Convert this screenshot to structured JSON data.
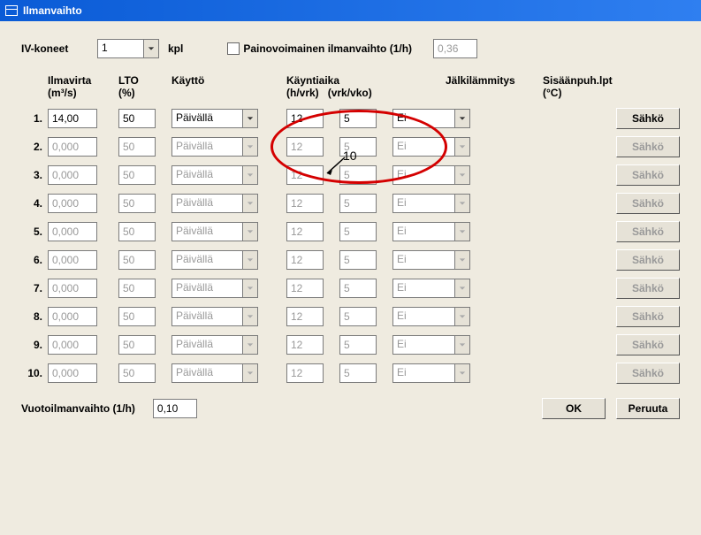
{
  "window": {
    "title": "Ilmanvaihto"
  },
  "top": {
    "ivkoneet_label": "IV-koneet",
    "ivkoneet_value": "1",
    "kpl_label": "kpl",
    "painov_label": "Painovoimainen ilmanvaihto (1/h)",
    "painov_value": "0,36"
  },
  "headers": {
    "ilmavirta": "Ilmavirta",
    "ilmavirta_unit": "(m³/s)",
    "lto": "LTO",
    "lto_unit": "(%)",
    "kaytto": "Käyttö",
    "kayntiaika": "Käyntiaika",
    "h_vrk": "(h/vrk)",
    "vrk_vko": "(vrk/vko)",
    "jalki": "Jälkilämmitys",
    "sisaan": "Sisäänpuh.lpt",
    "sisaan_unit": "(°C)"
  },
  "rows": [
    {
      "num": "1.",
      "ilm": "14,00",
      "lto": "50",
      "kay": "Päivällä",
      "h": "12",
      "v": "5",
      "jal": "Ei",
      "btn": "Sähkö",
      "enabled": true
    },
    {
      "num": "2.",
      "ilm": "0,000",
      "lto": "50",
      "kay": "Päivällä",
      "h": "12",
      "v": "5",
      "jal": "Ei",
      "btn": "Sähkö",
      "enabled": false
    },
    {
      "num": "3.",
      "ilm": "0,000",
      "lto": "50",
      "kay": "Päivällä",
      "h": "12",
      "v": "5",
      "jal": "Ei",
      "btn": "Sähkö",
      "enabled": false
    },
    {
      "num": "4.",
      "ilm": "0,000",
      "lto": "50",
      "kay": "Päivällä",
      "h": "12",
      "v": "5",
      "jal": "Ei",
      "btn": "Sähkö",
      "enabled": false
    },
    {
      "num": "5.",
      "ilm": "0,000",
      "lto": "50",
      "kay": "Päivällä",
      "h": "12",
      "v": "5",
      "jal": "Ei",
      "btn": "Sähkö",
      "enabled": false
    },
    {
      "num": "6.",
      "ilm": "0,000",
      "lto": "50",
      "kay": "Päivällä",
      "h": "12",
      "v": "5",
      "jal": "Ei",
      "btn": "Sähkö",
      "enabled": false
    },
    {
      "num": "7.",
      "ilm": "0,000",
      "lto": "50",
      "kay": "Päivällä",
      "h": "12",
      "v": "5",
      "jal": "Ei",
      "btn": "Sähkö",
      "enabled": false
    },
    {
      "num": "8.",
      "ilm": "0,000",
      "lto": "50",
      "kay": "Päivällä",
      "h": "12",
      "v": "5",
      "jal": "Ei",
      "btn": "Sähkö",
      "enabled": false
    },
    {
      "num": "9.",
      "ilm": "0,000",
      "lto": "50",
      "kay": "Päivällä",
      "h": "12",
      "v": "5",
      "jal": "Ei",
      "btn": "Sähkö",
      "enabled": false
    },
    {
      "num": "10.",
      "ilm": "0,000",
      "lto": "50",
      "kay": "Päivällä",
      "h": "12",
      "v": "5",
      "jal": "Ei",
      "btn": "Sähkö",
      "enabled": false
    }
  ],
  "bottom": {
    "vuoto_label": "Vuotoilmanvaihto (1/h)",
    "vuoto_value": "0,10",
    "ok": "OK",
    "cancel": "Peruuta"
  },
  "annotation": {
    "label": "10"
  }
}
